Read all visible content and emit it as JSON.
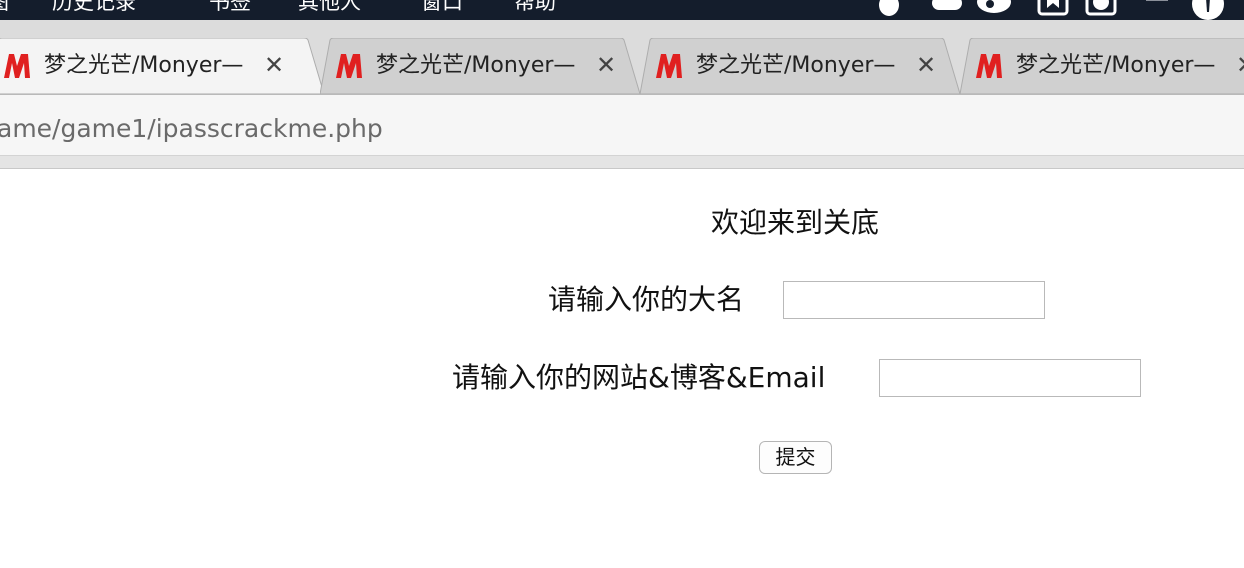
{
  "menubar": {
    "items": [
      "图",
      "历史记录",
      "书签",
      "其他人",
      "窗口",
      "帮助"
    ]
  },
  "tabs": [
    {
      "title": "梦之光芒/Monyer—",
      "close": "✕"
    },
    {
      "title": "梦之光芒/Monyer—",
      "close": "✕"
    },
    {
      "title": "梦之光芒/Monyer—",
      "close": "✕"
    },
    {
      "title": "梦之光芒/Monyer—",
      "close": "✕"
    }
  ],
  "address_bar": {
    "url": "ame/game1/ipasscrackme.php"
  },
  "page": {
    "heading": "欢迎来到关底",
    "name_label": "请输入你的大名",
    "name_value": "",
    "site_label": "请输入你的网站&博客&Email",
    "site_value": "",
    "submit_label": "提交"
  },
  "colors": {
    "menubar_bg": "#141d2c",
    "favicon_red": "#e02020",
    "tabstrip_bg": "#dcdcdc",
    "active_tab_bg": "#f4f4f4"
  }
}
